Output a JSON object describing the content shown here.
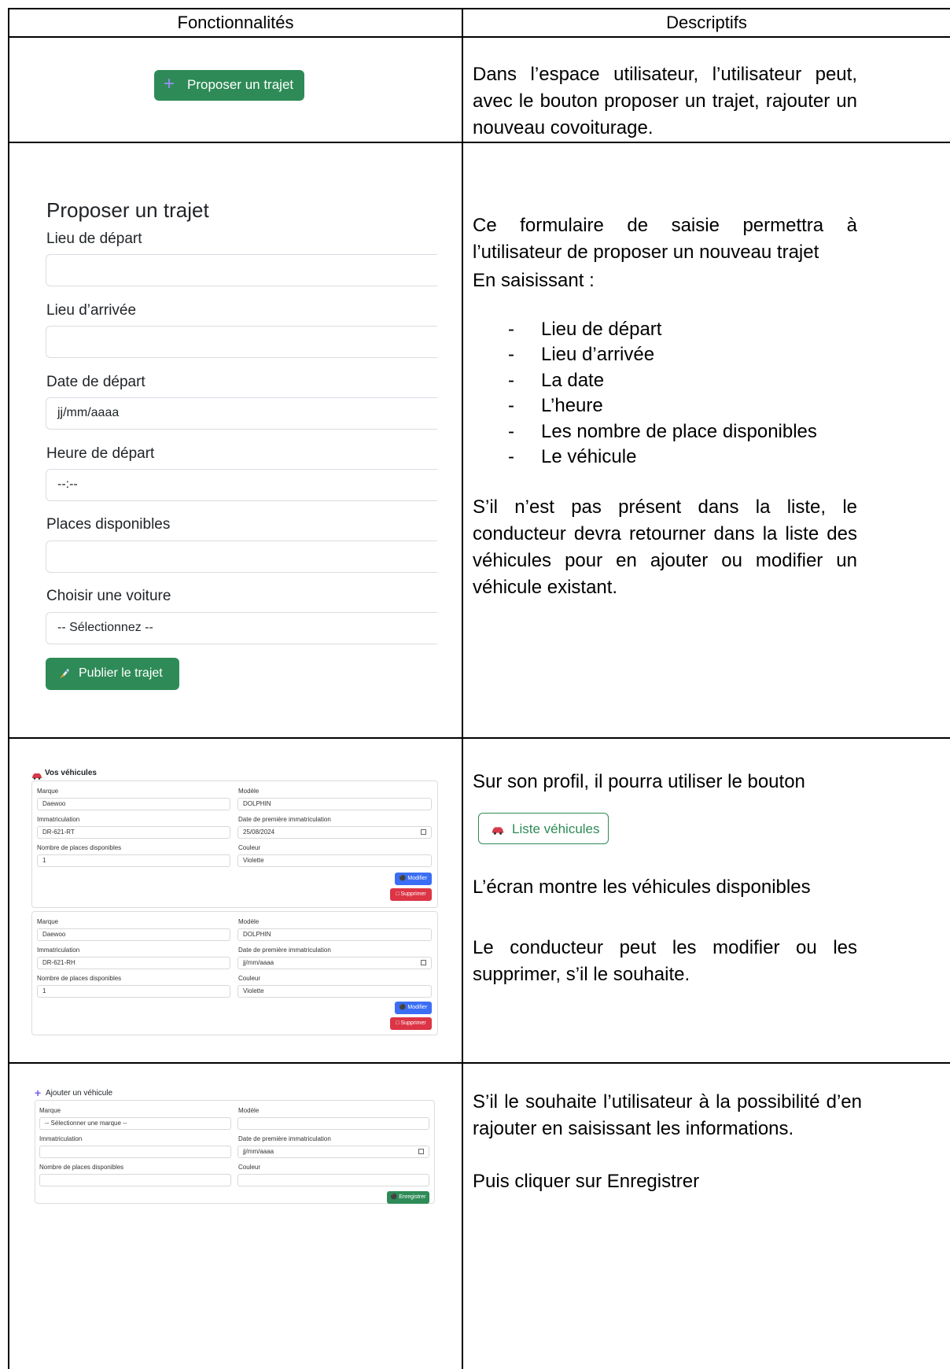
{
  "header": {
    "col1": "Fonctionnalités",
    "col2": "Descriptifs"
  },
  "row1": {
    "button_label": "Proposer un trajet",
    "description": "Dans l’espace utilisateur, l’utilisateur peut, avec le bouton proposer un trajet, rajouter un nouveau covoiturage."
  },
  "row2": {
    "form": {
      "title": "Proposer un trajet",
      "fields": [
        {
          "label": "Lieu de départ",
          "value": ""
        },
        {
          "label": "Lieu d’arrivée",
          "value": ""
        },
        {
          "label": "Date de départ",
          "value": "jj/mm/aaaa"
        },
        {
          "label": "Heure de départ",
          "value": "--:--"
        },
        {
          "label": "Places disponibles",
          "value": ""
        },
        {
          "label": "Choisir une voiture",
          "value": "-- Sélectionnez --"
        }
      ],
      "submit_label": "Publier le trajet"
    },
    "desc_intro": "Ce formulaire de saisie permettra à l’utilisateur de proposer un nouveau trajet",
    "desc_en": "En saisissant :",
    "bullets": [
      "Lieu de départ",
      "Lieu d’arrivée",
      "La date",
      "L’heure",
      "Les nombre de place disponibles",
      "Le véhicule"
    ],
    "desc_note": "S’il n’est pas présent dans la liste, le conducteur devra retourner dans la liste des véhicules pour en ajouter ou modifier un véhicule existant."
  },
  "row3": {
    "title": "Vos véhicules",
    "labels": {
      "marque": "Marque",
      "modele": "Modèle",
      "immat": "Immatriculation",
      "date": "Date de première immatriculation",
      "places": "Nombre de places disponibles",
      "couleur": "Couleur"
    },
    "vehicles": [
      {
        "marque": "Daewoo",
        "modele": "DOLPHIN",
        "immat": "DR-621-RT",
        "date": "25/08/2024",
        "places": "1",
        "couleur": "Violette"
      },
      {
        "marque": "Daewoo",
        "modele": "DOLPHIN",
        "immat": "DR-621-RH",
        "date": "jj/mm/aaaa",
        "places": "1",
        "couleur": "Violette"
      }
    ],
    "btn_modifier": "Modifier",
    "btn_supprimer": "Supprimer",
    "desc_profile": "Sur son profil, il pourra utiliser le bouton",
    "list_button": "Liste véhicules",
    "desc_screen": "L’écran montre les véhicules disponibles",
    "desc_modify": "Le conducteur peut les modifier ou les supprimer, s’il le souhaite."
  },
  "row4": {
    "title": "Ajouter un véhicule",
    "labels": {
      "marque": "Marque",
      "modele": "Modèle",
      "immat": "Immatriculation",
      "date": "Date de première immatriculation",
      "places": "Nombre de places disponibles",
      "couleur": "Couleur"
    },
    "marque_placeholder": "-- Sélectionner une marque --",
    "date_placeholder": "jj/mm/aaaa",
    "save_label": "Enregistrer",
    "desc_1": "S’il le souhaite l’utilisateur à la possibilité d’en rajouter en saisissant les informations.",
    "desc_2": "Puis cliquer sur Enregistrer"
  },
  "colors": {
    "green": "#2e8b57",
    "blue": "#3b6ef5",
    "red": "#dc3545",
    "purple_plus": "#8b5cf6"
  }
}
